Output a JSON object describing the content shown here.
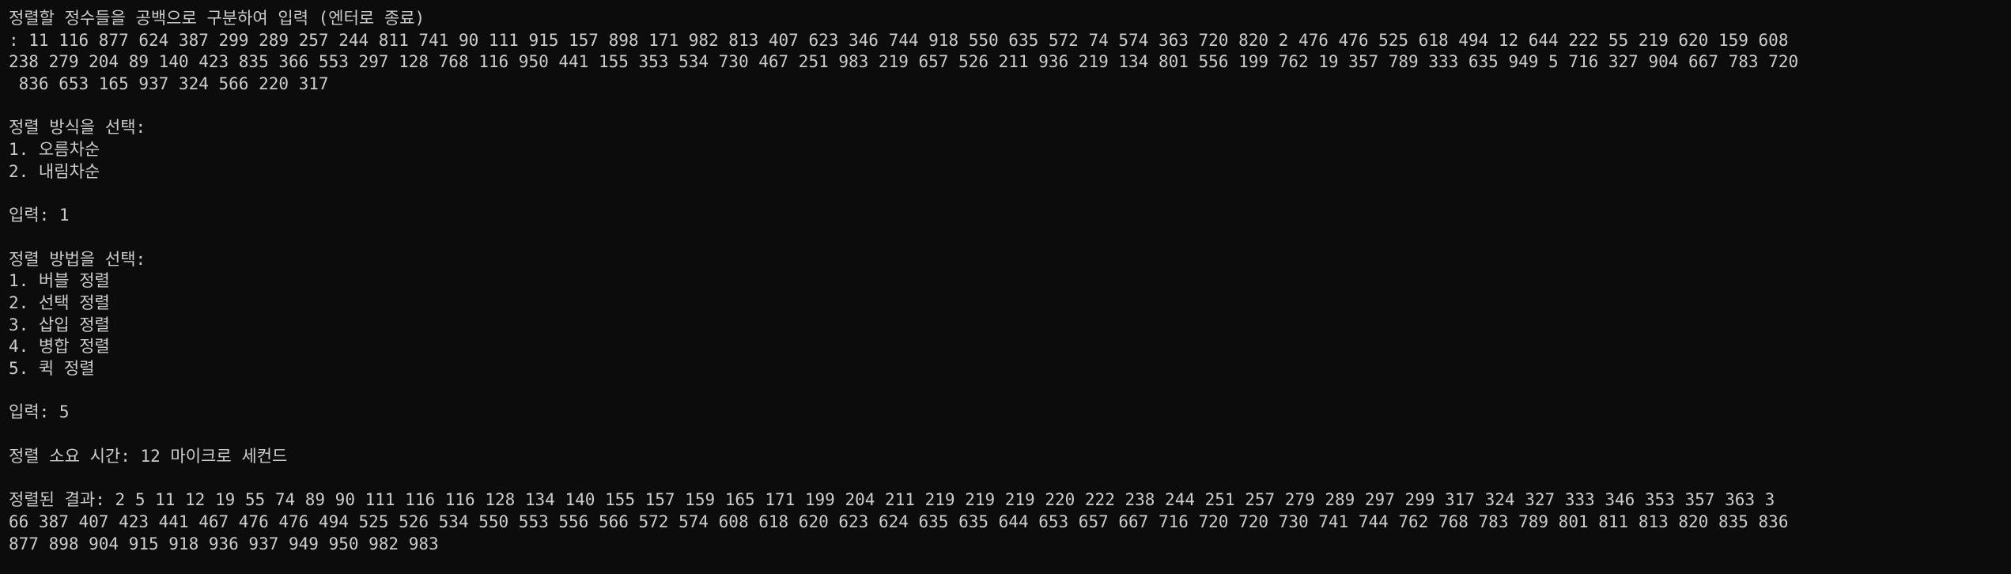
{
  "terminal": {
    "background": "#0c0c0c",
    "foreground": "#cccccc",
    "lines": [
      "정렬할 정수들을 공백으로 구분하여 입력 (엔터로 종료)",
      ": 11 116 877 624 387 299 289 257 244 811 741 90 111 915 157 898 171 982 813 407 623 346 744 918 550 635 572 74 574 363 720 820 2 476 476 525 618 494 12 644 222 55 219 620 159 608",
      "238 279 204 89 140 423 835 366 553 297 128 768 116 950 441 155 353 534 730 467 251 983 219 657 526 211 936 219 134 801 556 199 762 19 357 789 333 635 949 5 716 327 904 667 783 720",
      " 836 653 165 937 324 566 220 317",
      "",
      "정렬 방식을 선택:",
      "1. 오름차순",
      "2. 내림차순",
      "",
      "입력: 1",
      "",
      "정렬 방법을 선택:",
      "1. 버블 정렬",
      "2. 선택 정렬",
      "3. 삽입 정렬",
      "4. 병합 정렬",
      "5. 퀵 정렬",
      "",
      "입력: 5",
      "",
      "정렬 소요 시간: 12 마이크로 세컨드",
      "",
      "정렬된 결과: 2 5 11 12 19 55 74 89 90 111 116 116 128 134 140 155 157 159 165 171 199 204 211 219 219 219 220 222 238 244 251 257 279 289 297 299 317 324 327 333 346 353 357 363 3",
      "66 387 407 423 441 467 476 476 494 525 526 534 550 553 556 566 572 574 608 618 620 623 624 635 635 644 653 657 667 716 720 720 730 741 744 762 768 783 789 801 811 813 820 835 836",
      "877 898 904 915 918 936 937 949 950 982 983"
    ]
  }
}
